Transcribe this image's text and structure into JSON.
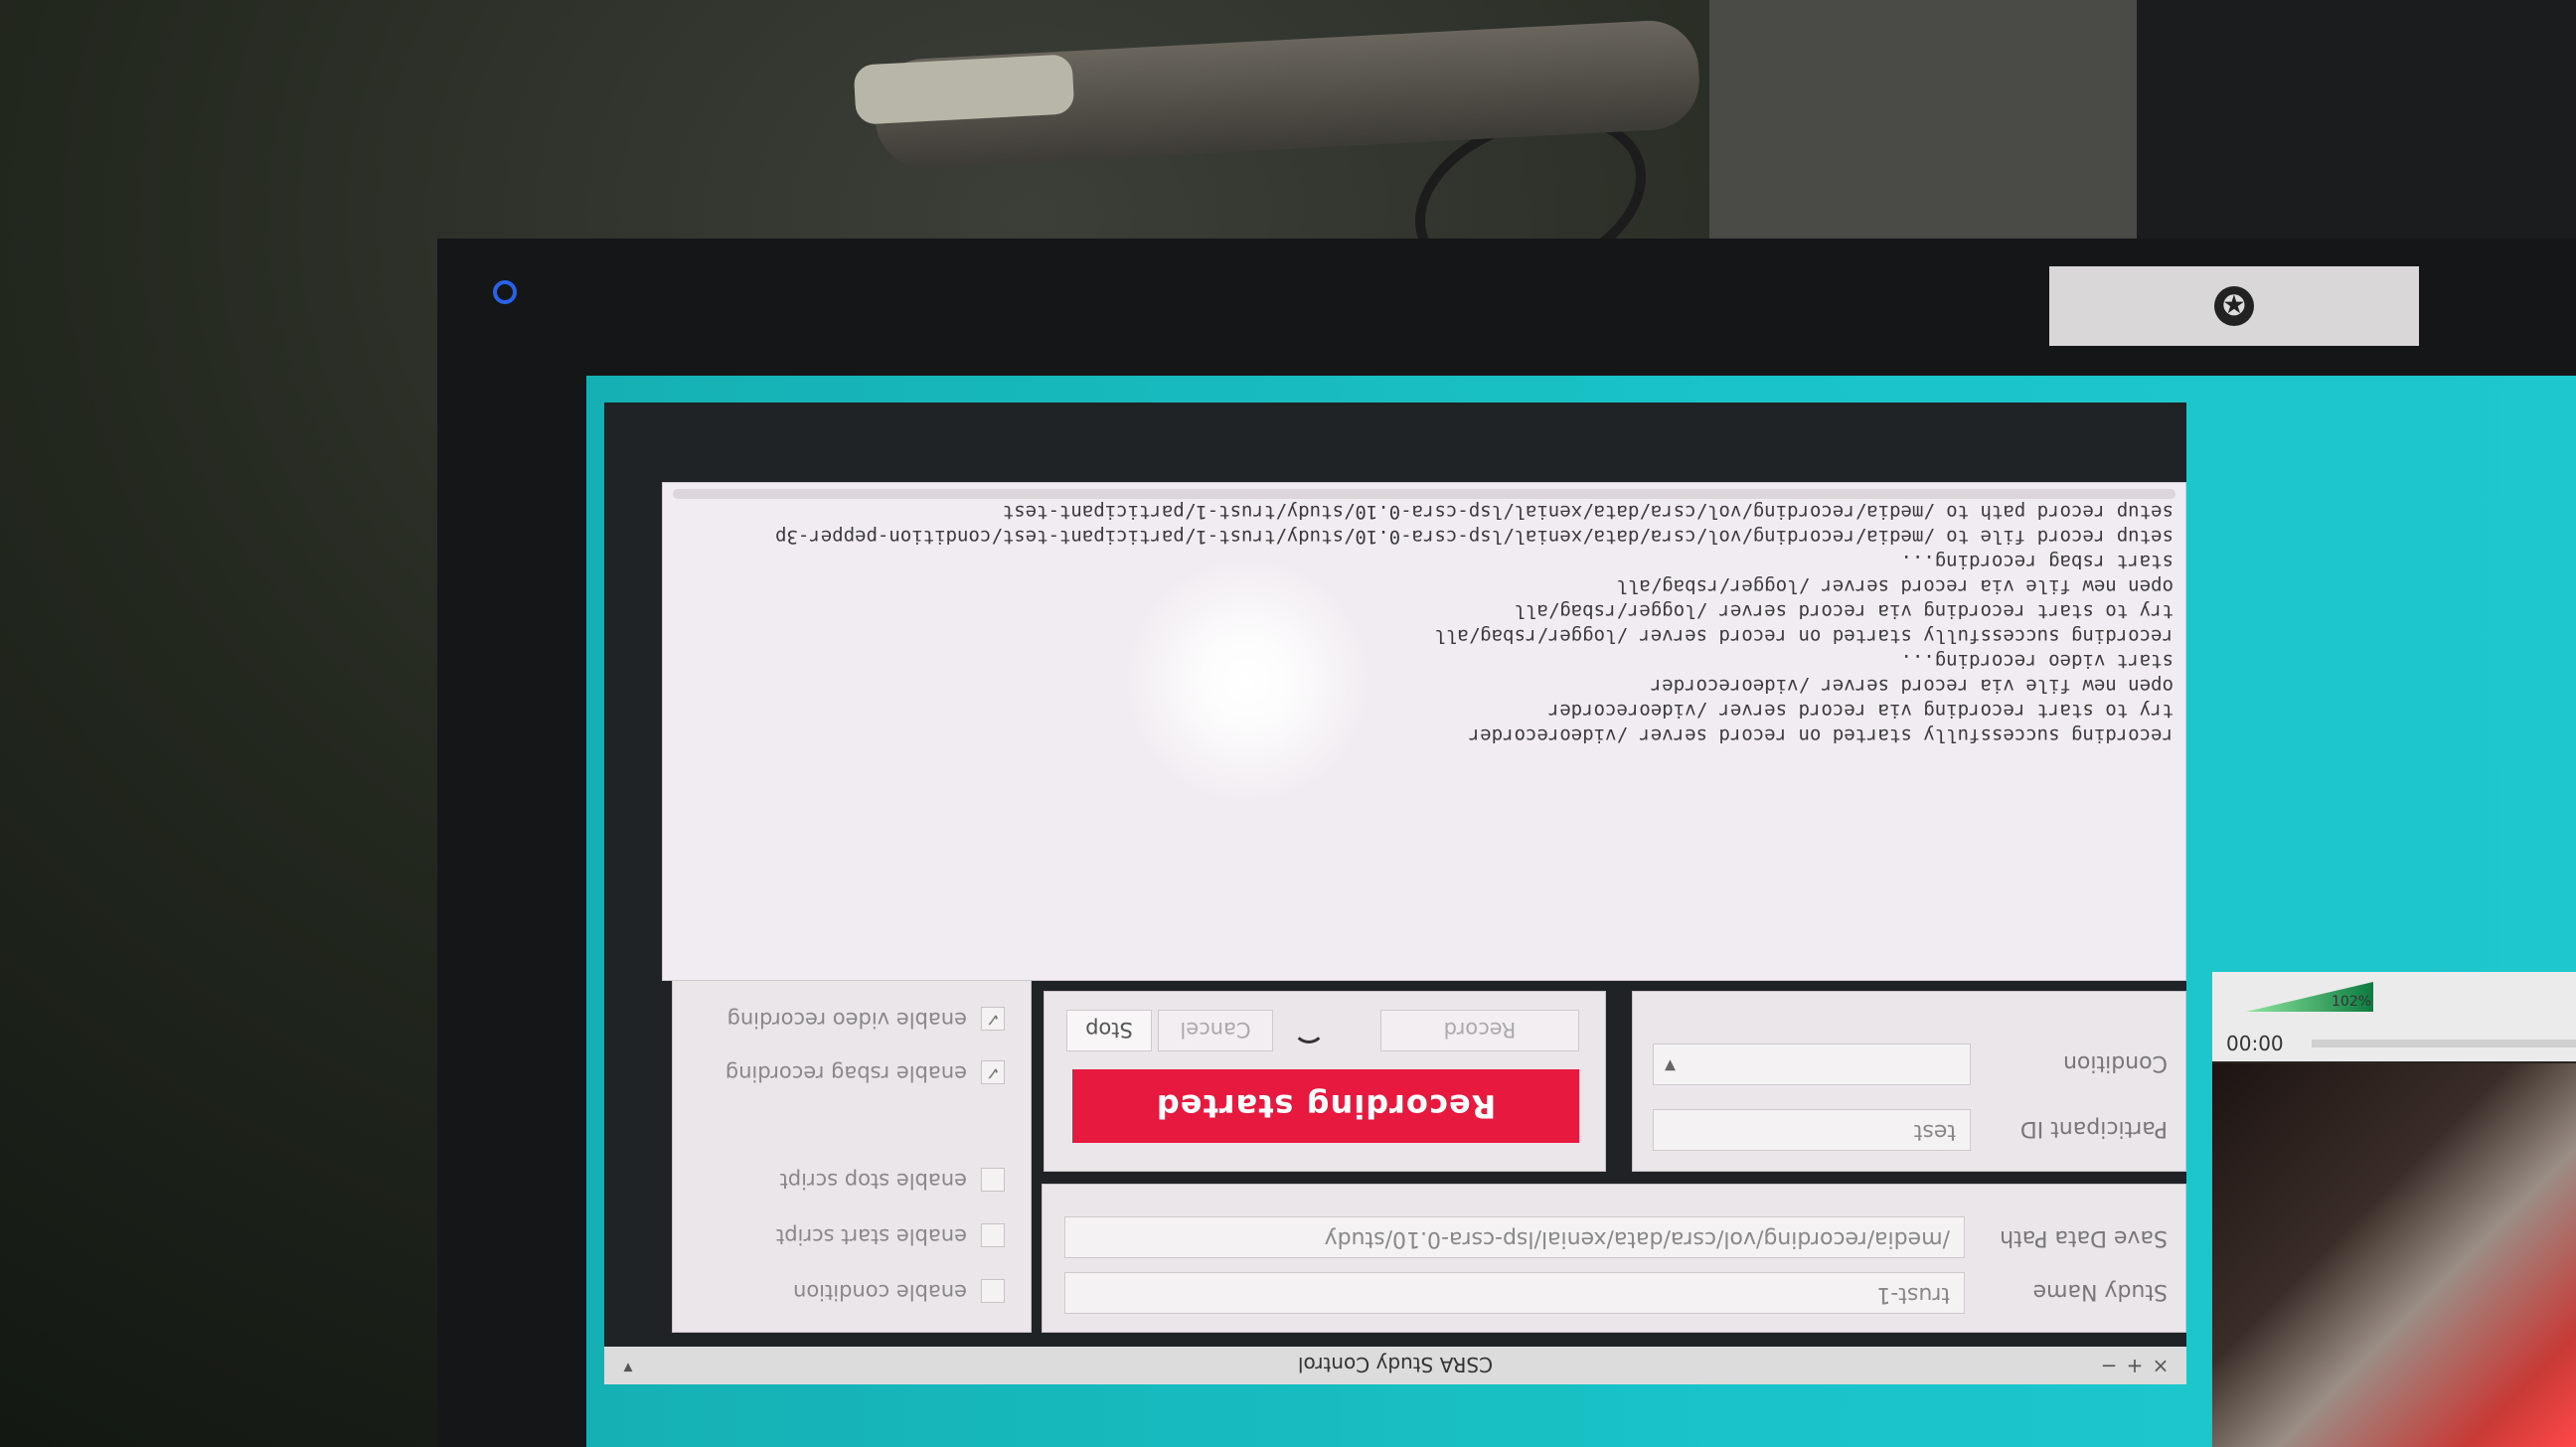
{
  "window": {
    "title": "CSRA Study Control",
    "controls": [
      "−",
      "+",
      "×"
    ]
  },
  "study": {
    "name_label": "Study Name",
    "name_value": "trust-1",
    "path_label": "Save Data Path",
    "path_value": "/media/recording/vol/csra/data/xenial/lsp-csra-0.10/study"
  },
  "participant": {
    "id_label": "Participant ID",
    "id_value": "test",
    "condition_label": "Condition",
    "condition_value": ""
  },
  "recording": {
    "status": "Recording started",
    "status_color": "#e8193f",
    "record_label": "Record",
    "cancel_label": "Cancel",
    "stop_label": "Stop"
  },
  "options": {
    "enable_condition": "enable condition",
    "enable_start_script": "enable start script",
    "enable_stop_script": "enable stop script",
    "enable_rsbag_recording": "enable rsbag recording",
    "enable_video_recording": "enable video recording",
    "check_mark": "✓"
  },
  "log": {
    "lines": [
      "setup record path to /media/recording/vol/csra/data/xenial/lsp-csra-0.10/study/trust-1/participant-test",
      "setup record file to /media/recording/vol/csra/data/xenial/lsp-csra-0.10/study/trust-1/participant-test/condition-pepper-3p",
      "start rsbag recording...",
      "open new file via record server /logger/rsbag/all",
      "try to start recording via record server /logger/rsbag/all",
      "recording successfully started on record server /logger/rsbag/all",
      "start video recording...",
      "open new file via record server /videorecorder",
      "try to start recording via record server /videorecorder",
      "recording successfully started on record server /videorecorder"
    ]
  },
  "side_window": {
    "time": "00:00",
    "volume": "102%"
  }
}
